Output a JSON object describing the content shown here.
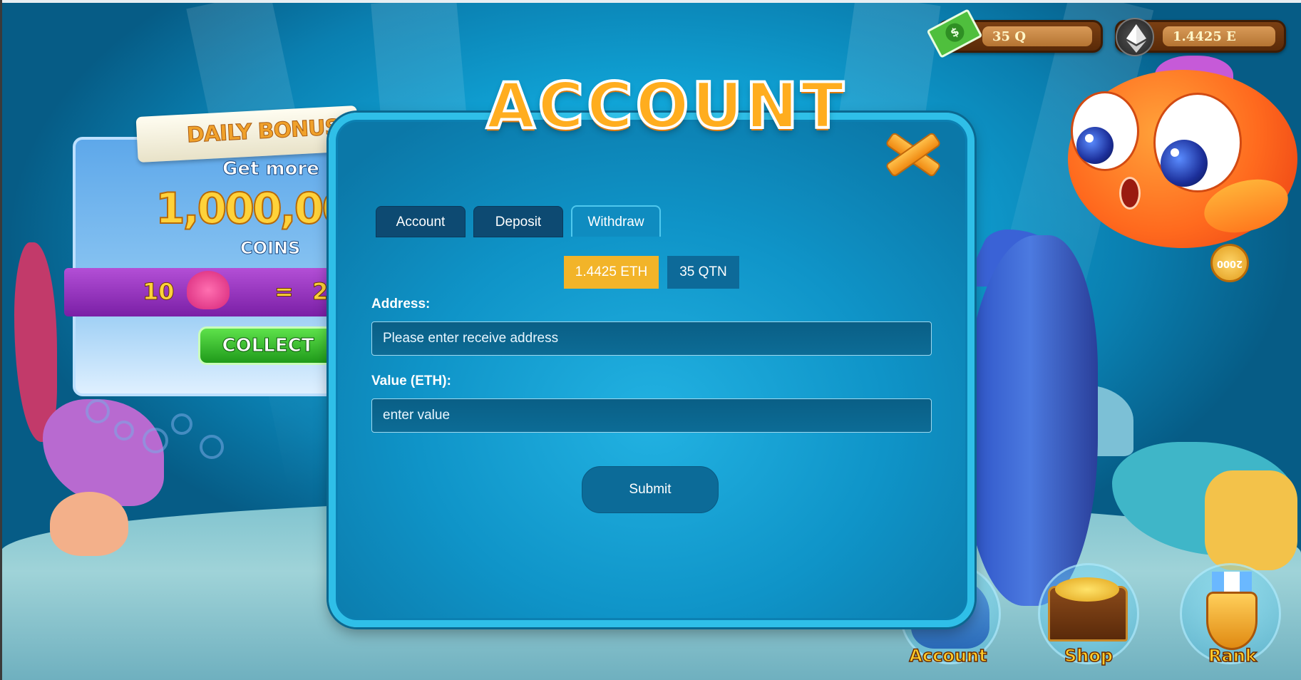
{
  "balances": {
    "cash_value": "35 Q",
    "eth_value": "1.4425 E"
  },
  "daily_bonus": {
    "banner": "DAILY BONUS",
    "get_more": "Get more",
    "amount": "1,000,00",
    "coins": "COINS",
    "rate_left": "10",
    "rate_eq": "=",
    "rate_right": "2",
    "collect_label": "COLLECT"
  },
  "fish": {
    "coin_label": "2000"
  },
  "modal": {
    "title": "ACCOUNT",
    "tabs": [
      {
        "label": "Account",
        "active": false
      },
      {
        "label": "Deposit",
        "active": false
      },
      {
        "label": "Withdraw",
        "active": true
      }
    ],
    "currencies": [
      {
        "label": "1.4425 ETH",
        "selected": true
      },
      {
        "label": "35 QTN",
        "selected": false
      }
    ],
    "address_label": "Address:",
    "address_placeholder": "Please enter receive address",
    "value_label": "Value (ETH):",
    "value_placeholder": "enter value",
    "submit_label": "Submit"
  },
  "bottom_nav": [
    {
      "label": "Account",
      "icon": "account-character-icon"
    },
    {
      "label": "Shop",
      "icon": "treasure-chest-icon"
    },
    {
      "label": "Rank",
      "icon": "medal-icon"
    }
  ],
  "colors": {
    "accent_orange": "#ffad1e",
    "selected_currency": "#f2b429",
    "tab_dark": "#0d4a72",
    "modal_border": "#2fbfe8"
  }
}
